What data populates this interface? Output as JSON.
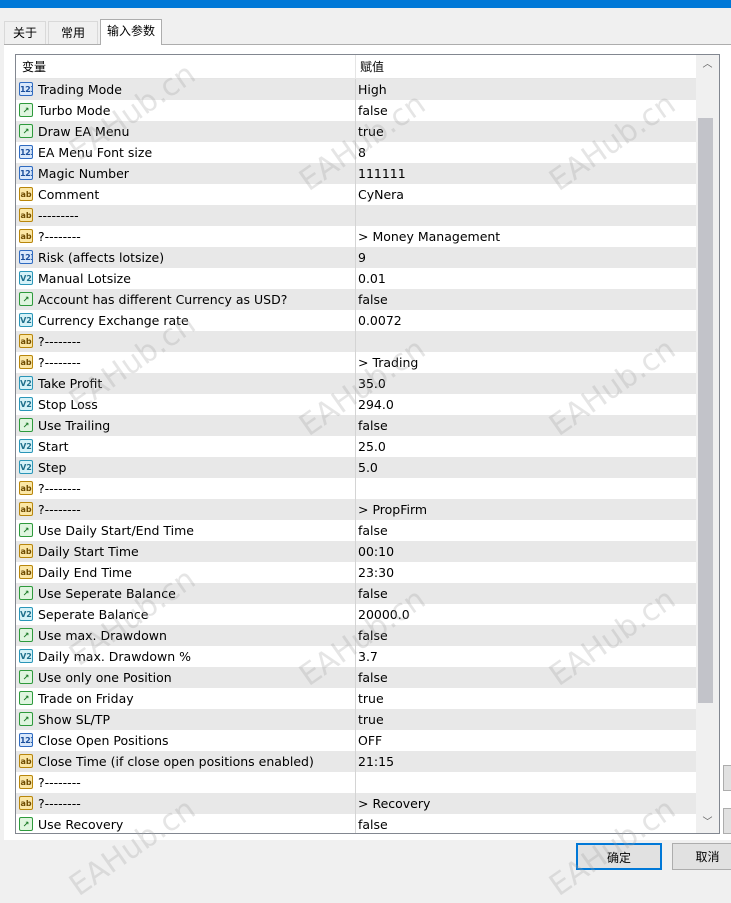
{
  "tabs": [
    {
      "label": "关于",
      "active": false
    },
    {
      "label": "常用",
      "active": false
    },
    {
      "label": "输入参数",
      "active": true
    }
  ],
  "table": {
    "col_variable": "变量",
    "col_value": "赋值",
    "rows": [
      {
        "type": "int",
        "name": "Trading Mode",
        "value": "High"
      },
      {
        "type": "bool",
        "name": "Turbo Mode",
        "value": "false"
      },
      {
        "type": "bool",
        "name": "Draw EA Menu",
        "value": "true"
      },
      {
        "type": "int",
        "name": "EA Menu Font size",
        "value": "8"
      },
      {
        "type": "int",
        "name": "Magic Number",
        "value": "111111"
      },
      {
        "type": "str",
        "name": "Comment",
        "value": "CyNera"
      },
      {
        "type": "str",
        "name": "---------",
        "value": ""
      },
      {
        "type": "str",
        "name": "?--------",
        "value": "  > Money Management"
      },
      {
        "type": "int",
        "name": "Risk (affects lotsize)",
        "value": "9"
      },
      {
        "type": "dbl",
        "name": "Manual Lotsize",
        "value": "0.01"
      },
      {
        "type": "bool",
        "name": "Account has different Currency as USD?",
        "value": "false"
      },
      {
        "type": "dbl",
        "name": "Currency Exchange rate",
        "value": "0.0072"
      },
      {
        "type": "str",
        "name": "?--------",
        "value": ""
      },
      {
        "type": "str",
        "name": "?--------",
        "value": "  > Trading"
      },
      {
        "type": "dbl",
        "name": "Take Profit",
        "value": "35.0"
      },
      {
        "type": "dbl",
        "name": "Stop Loss",
        "value": "294.0"
      },
      {
        "type": "bool",
        "name": "Use Trailing",
        "value": "false"
      },
      {
        "type": "dbl",
        "name": "Start",
        "value": "25.0"
      },
      {
        "type": "dbl",
        "name": "Step",
        "value": "5.0"
      },
      {
        "type": "str",
        "name": "?--------",
        "value": ""
      },
      {
        "type": "str",
        "name": "?--------",
        "value": "  > PropFirm"
      },
      {
        "type": "bool",
        "name": "Use Daily Start/End Time",
        "value": "false"
      },
      {
        "type": "str",
        "name": "Daily Start Time",
        "value": "00:10"
      },
      {
        "type": "str",
        "name": "Daily End Time",
        "value": "23:30"
      },
      {
        "type": "bool",
        "name": "Use Seperate Balance",
        "value": "false"
      },
      {
        "type": "dbl",
        "name": "Seperate Balance",
        "value": "20000.0"
      },
      {
        "type": "bool",
        "name": "Use max. Drawdown",
        "value": "false"
      },
      {
        "type": "dbl",
        "name": "Daily max. Drawdown %",
        "value": "3.7"
      },
      {
        "type": "bool",
        "name": "Use only one Position",
        "value": "false"
      },
      {
        "type": "bool",
        "name": "Trade on Friday",
        "value": "true"
      },
      {
        "type": "bool",
        "name": "Show SL/TP",
        "value": "true"
      },
      {
        "type": "int",
        "name": "Close Open Positions",
        "value": "OFF"
      },
      {
        "type": "str",
        "name": "Close Time (if close open positions enabled)",
        "value": "21:15"
      },
      {
        "type": "str",
        "name": "?--------",
        "value": ""
      },
      {
        "type": "str",
        "name": "?--------",
        "value": "  > Recovery"
      },
      {
        "type": "bool",
        "name": "Use Recovery",
        "value": "false"
      }
    ]
  },
  "type_icons": {
    "int": {
      "glyph": "123",
      "icon": "integer-type-icon"
    },
    "str": {
      "glyph": "ab",
      "icon": "string-type-icon"
    },
    "bool": {
      "glyph": "↗",
      "icon": "boolean-type-icon"
    },
    "dbl": {
      "glyph": "V2",
      "icon": "double-type-icon"
    }
  },
  "buttons": {
    "ok": "确定",
    "cancel": "取消"
  },
  "watermark": "EAHub.cn",
  "colors": {
    "accent": "#0078d7",
    "row_alt": "#e8e8e8"
  }
}
